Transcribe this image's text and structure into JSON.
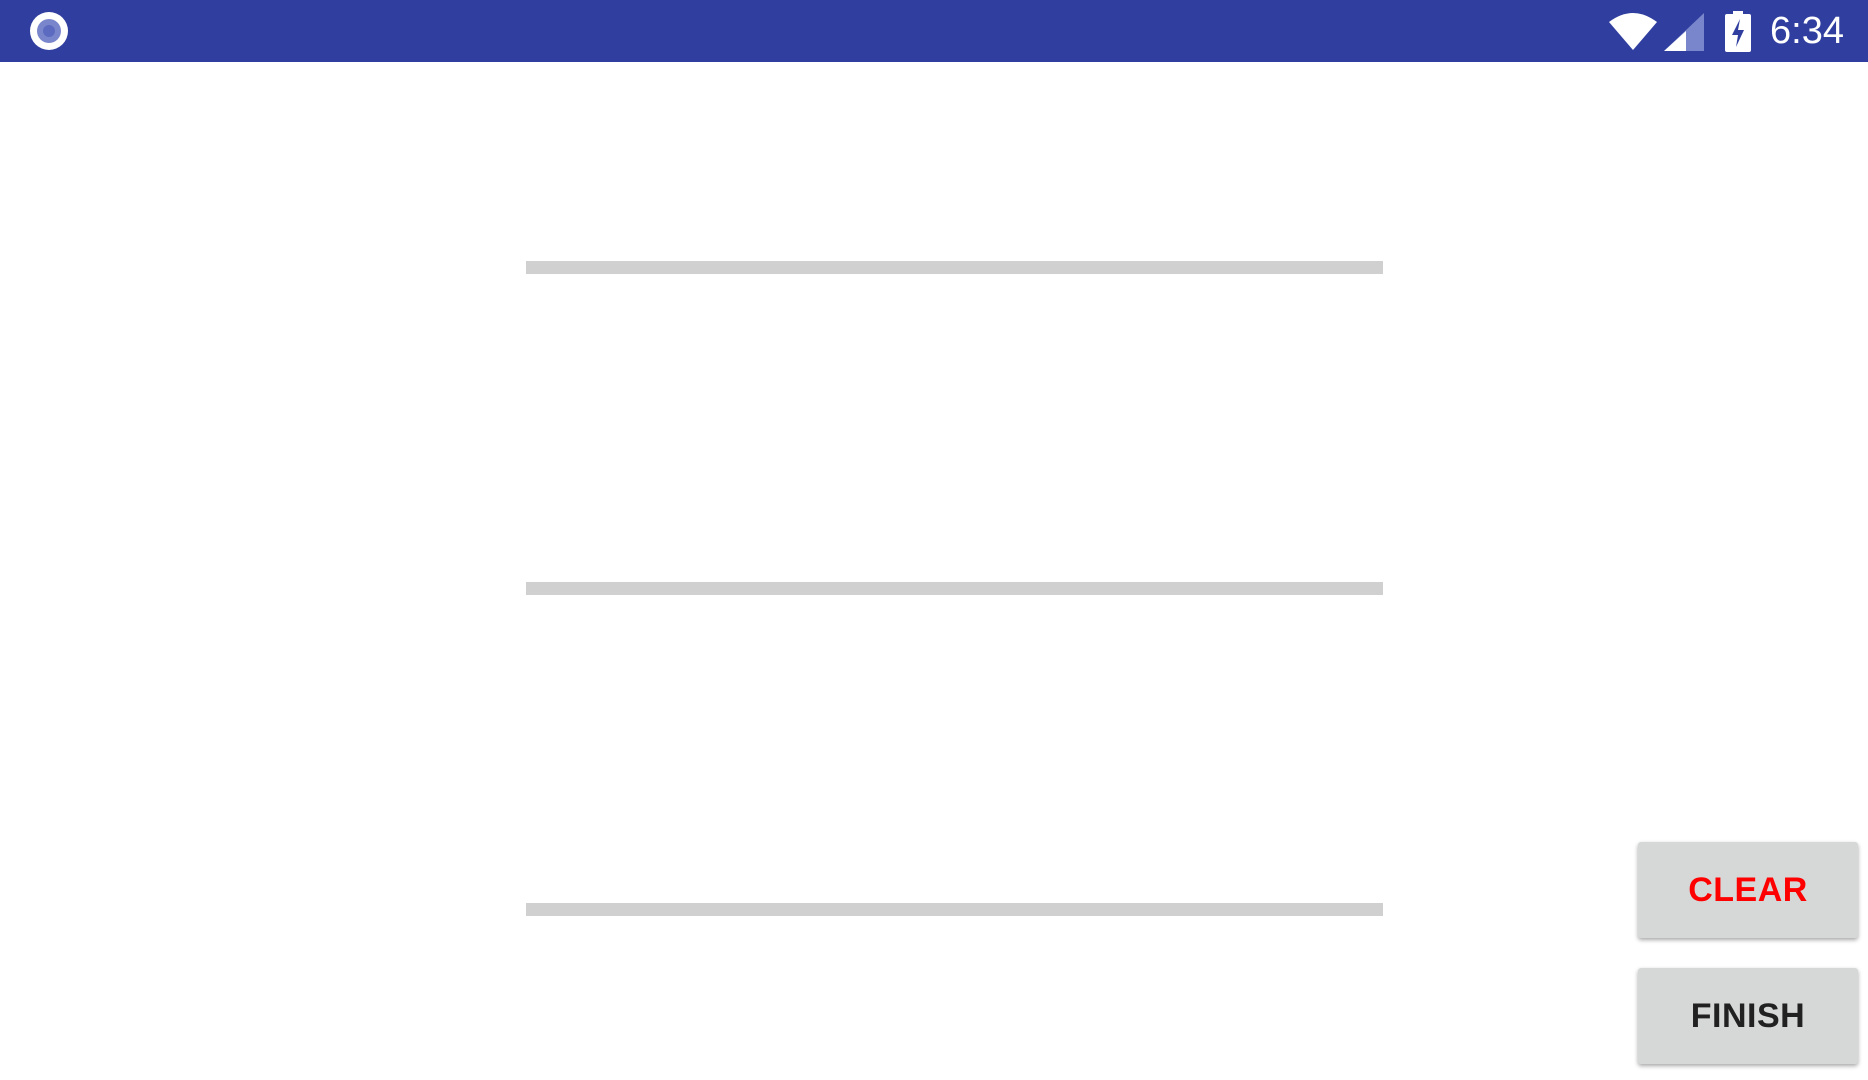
{
  "status_bar": {
    "background": "#303f9f",
    "notification_icon": "record-circle-icon",
    "wifi_icon": "wifi-icon",
    "signal_icon": "cell-signal-icon",
    "battery_icon": "battery-charging-icon",
    "time": "6:34"
  },
  "fields": [
    {
      "name": "line-field-1",
      "value": ""
    },
    {
      "name": "line-field-2",
      "value": ""
    },
    {
      "name": "line-field-3",
      "value": ""
    }
  ],
  "buttons": {
    "clear_label": "CLEAR",
    "clear_color": "#ff0000",
    "finish_label": "FINISH",
    "finish_color": "#212121"
  }
}
